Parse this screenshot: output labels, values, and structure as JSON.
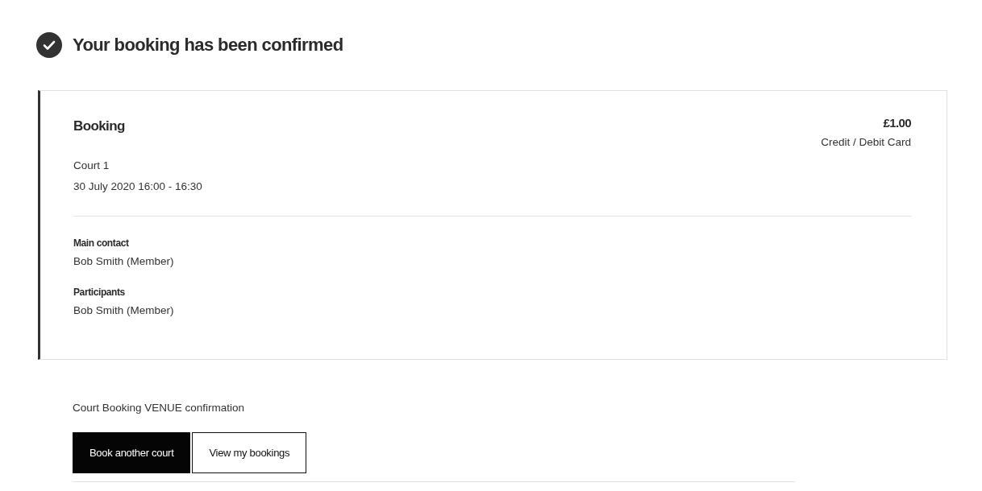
{
  "header": {
    "title": "Your booking has been confirmed"
  },
  "booking": {
    "title": "Booking",
    "price": "£1.00",
    "payment_method": "Credit / Debit Card",
    "court": "Court 1",
    "datetime": "30 July 2020 16:00 - 16:30",
    "details": [
      {
        "label": "Main contact",
        "value": "Bob Smith (Member)"
      },
      {
        "label": "Participants",
        "value": "Bob Smith (Member)"
      }
    ]
  },
  "footer": {
    "note": "Court Booking VENUE confirmation",
    "buttons": [
      {
        "label": "Book another court",
        "kind": "primary"
      },
      {
        "label": "View my bookings",
        "kind": "secondary"
      }
    ]
  }
}
